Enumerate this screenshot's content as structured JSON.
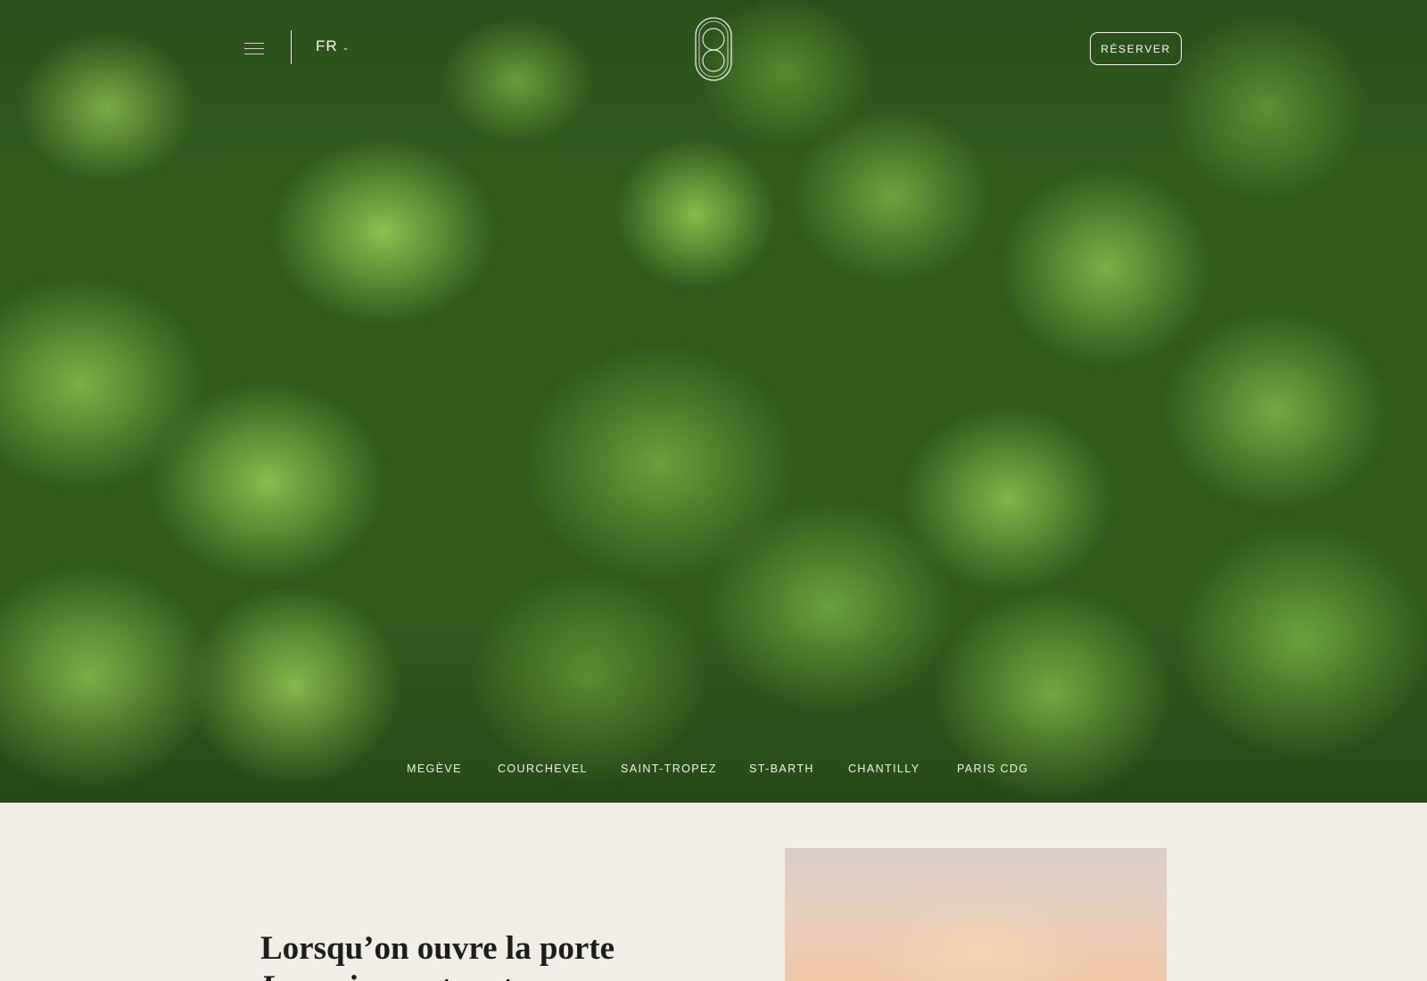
{
  "header": {
    "menu_icon": "hamburger-menu-icon",
    "language": "FR",
    "language_icon": "chevron-down-icon",
    "logo_icon": "brand-monogram-logo",
    "reserve_label": "RÉSERVER"
  },
  "hero": {
    "background": "aerial-forest-image",
    "destinations": [
      "MEGÈVE",
      "COURCHEVEL",
      "SAINT-TROPEZ",
      "ST-BARTH",
      "CHANTILLY",
      "PARIS CDG"
    ]
  },
  "intro": {
    "title_line1": "Lorsqu’on ouvre la porte",
    "title_line2": "La maison est vaste"
  },
  "colors": {
    "page_background": "#f1ede7",
    "text_dark": "#1d1d1b",
    "overlay_text": "#ffffff"
  }
}
